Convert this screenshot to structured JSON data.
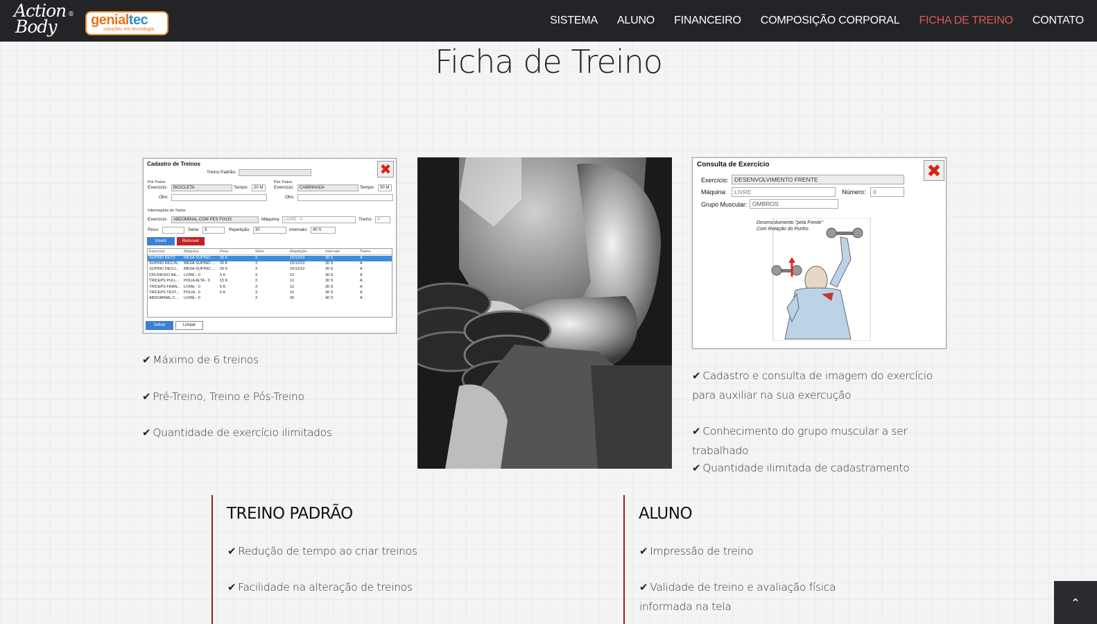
{
  "brand": {
    "logo_line1": "Action",
    "logo_line2": "Body",
    "logo_reg": "®",
    "partner_name_a": "genial",
    "partner_name_b": "tec",
    "partner_tagline": "soluções em tecnologia"
  },
  "nav": {
    "items": [
      {
        "label": "SISTEMA",
        "active": false
      },
      {
        "label": "ALUNO",
        "active": false
      },
      {
        "label": "FINANCEIRO",
        "active": false
      },
      {
        "label": "COMPOSIÇÃO CORPORAL",
        "active": false
      },
      {
        "label": "FICHA DE TREINO",
        "active": true
      },
      {
        "label": "CONTATO",
        "active": false
      }
    ],
    "active_color": "#e05656"
  },
  "page_title": "Ficha de Treino",
  "cadastro": {
    "title": "Cadastro de Treinos",
    "treino_padrao_label": "Treino Padrão:",
    "pre_treino_label": "Pré Treino",
    "pos_treino_label": "Pós Treino",
    "exercicio_label": "Exercício:",
    "tempo_label": "Tempo:",
    "obs_label": "Obs:",
    "pre_exercicio": "BICICLETA",
    "pre_tempo": "20 M",
    "pos_exercicio": "CAMINHADA",
    "pos_tempo": "30 M",
    "info_label": "Informações do Treino",
    "exercicio_value": "ABDOMINAL COM PÉS FIXOS",
    "maquina_label": "Máquina:",
    "maquina_value": "LIVRE - 0",
    "treino_label": "Treino:",
    "treino_value": "A",
    "peso_label": "Peso:",
    "serie_label": "Série:",
    "serie_value": "3",
    "repeticao_label": "Repetição:",
    "repeticao_value": "30",
    "intervalo_label": "Intervalo:",
    "intervalo_value": "40 S",
    "inserir_label": "Inserir",
    "remover_label": "Remover",
    "salvar_label": "Salvar",
    "limpar_label": "Limpar",
    "columns": [
      "Exercício",
      "Máquina",
      "Peso",
      "Série",
      "Repetição",
      "Intervalo",
      "Treino"
    ],
    "rows": [
      [
        "SUPINO RETO",
        "MESA-SUPINO ...",
        "20 K",
        "3",
        "15/12/10",
        "30 S",
        "A"
      ],
      [
        "SUPINO INCLIN...",
        "MESA-SUPINO ...",
        "20 K",
        "3",
        "15/12/10",
        "30 S",
        "A"
      ],
      [
        "SUPINO DECLI...",
        "MESA-SUPINO ...",
        "20 K",
        "3",
        "15/12/10",
        "30 S",
        "A"
      ],
      [
        "CRUXIFIXO RE...",
        "LIVRE - 0",
        "5 K",
        "3",
        "12",
        "30 S",
        "A"
      ],
      [
        "TRÍCEPS PULL...",
        "POLIA ALTA - 0",
        "15 K",
        "3",
        "12",
        "30 S",
        "A"
      ],
      [
        "TRÍCEPS FRAN...",
        "LIVRE - 0",
        "5 K",
        "3",
        "12",
        "30 S",
        "A"
      ],
      [
        "TRÍCEPS TEST...",
        "POLIA - 0",
        "5 K",
        "3",
        "10",
        "30 S",
        "A"
      ],
      [
        "ABDOMINAL C...",
        "LIVRE - 0",
        "",
        "3",
        "30",
        "40 S",
        "A"
      ]
    ]
  },
  "consulta": {
    "title": "Consulta de Exercício",
    "exercicio_label": "Exercício:",
    "exercicio_value": "DESENVOLVIMENTO FRENTE",
    "maquina_label": "Máquina:",
    "maquina_value": "LIVRE",
    "numero_label": "Número:",
    "numero_value": "0",
    "grupo_label": "Grupo Muscular:",
    "grupo_value": "OMBROS",
    "illus_caption": "Desenvolvimento \"pela Frente\" Com Rotação do Punho"
  },
  "left_features": [
    "Máximo de 6 treinos",
    "Pré-Treino, Treino e Pós-Treino",
    "Quantidade de exercício ilimitados"
  ],
  "right_features": [
    "Cadastro e consulta de imagem do exercício para auxiliar na sua exercução",
    "Conhecimento do grupo muscular a ser trabalhado",
    "Quantidade ilimitada de cadastramento"
  ],
  "treino_padrao": {
    "title": "TREINO PADRÃO",
    "items": [
      "Redução de tempo ao criar treinos",
      "Facilidade na alteração de treinos"
    ]
  },
  "aluno": {
    "title": "ALUNO",
    "items": [
      "Impressão de treino",
      "Validade de treino e avaliação física informada na tela"
    ]
  },
  "check_glyph": "✔",
  "to_top_glyph": "⌃"
}
